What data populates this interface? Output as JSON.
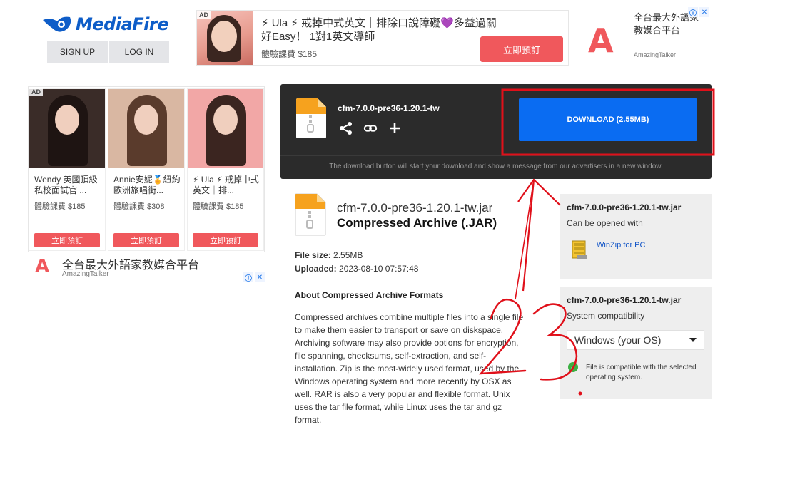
{
  "header": {
    "logo_text": "MediaFire",
    "signup_label": "SIGN UP",
    "login_label": "LOG IN"
  },
  "top_ad": {
    "badge": "AD",
    "title": "⚡ Ula ⚡ 戒掉中式英文｜排除口說障礙💜多益過關好Easy！ 1對1英文導師",
    "price": "體驗課費 $185",
    "cta": "立即預訂"
  },
  "top_right_ad": {
    "logo_letter": "A",
    "text": "全台最大外語家教媒合平台",
    "brand": "AmazingTalker"
  },
  "left_ad": {
    "badge": "AD",
    "cards": [
      {
        "name": "Wendy 英國頂級私校面試官 ...",
        "price": "體驗課費 $185",
        "cta": "立即預訂"
      },
      {
        "name": "Annie安妮🏅紐約歐洲旅唱街...",
        "price": "體驗課費 $308",
        "cta": "立即預訂"
      },
      {
        "name": "⚡ Ula ⚡ 戒掉中式英文｜排...",
        "price": "體驗課費 $185",
        "cta": "立即預訂"
      }
    ],
    "bottom_logo_letter": "A",
    "bottom_text": "全台最大外語家教媒合平台",
    "bottom_brand": "AmazingTalker"
  },
  "download_panel": {
    "filename": "cfm-7.0.0-pre36-1.20.1-tw",
    "button_label": "DOWNLOAD (2.55MB)",
    "note": "The download button will start your download and show a message from our advertisers in a new window."
  },
  "file_details": {
    "title": "cfm-7.0.0-pre36-1.20.1-tw.jar",
    "type": "Compressed Archive (.JAR)",
    "size_label": "File size:",
    "size_value": "2.55MB",
    "uploaded_label": "Uploaded:",
    "uploaded_value": "2023-08-10 07:57:48",
    "about_heading": "About Compressed Archive Formats",
    "about_text": "Compressed archives combine multiple files into a single file to make them easier to transport or save on diskspace. Archiving software may also provide options for encryption, file spanning, checksums, self-extraction, and self-installation. Zip is the most-widely used format, used by the Windows operating system and more recently by OSX as well. RAR is also a very popular and flexible format. Unix uses the tar file format, while Linux uses the tar and gz format."
  },
  "side_open": {
    "heading": "cfm-7.0.0-pre36-1.20.1-tw.jar",
    "sub": "Can be opened with",
    "app_link": "WinZip for PC"
  },
  "side_compat": {
    "heading": "cfm-7.0.0-pre36-1.20.1-tw.jar",
    "sub": "System compatibility",
    "os_selected": "Windows (your OS)",
    "compat_text": "File is compatible with the selected operating system."
  },
  "annotation": {
    "handwritten": "23.",
    "color": "#e0101a"
  },
  "colors": {
    "brand_blue": "#0e5dc8",
    "download_blue": "#0a6cf2",
    "ad_coral": "#f0585c",
    "panel_dark": "#2b2b2b"
  }
}
